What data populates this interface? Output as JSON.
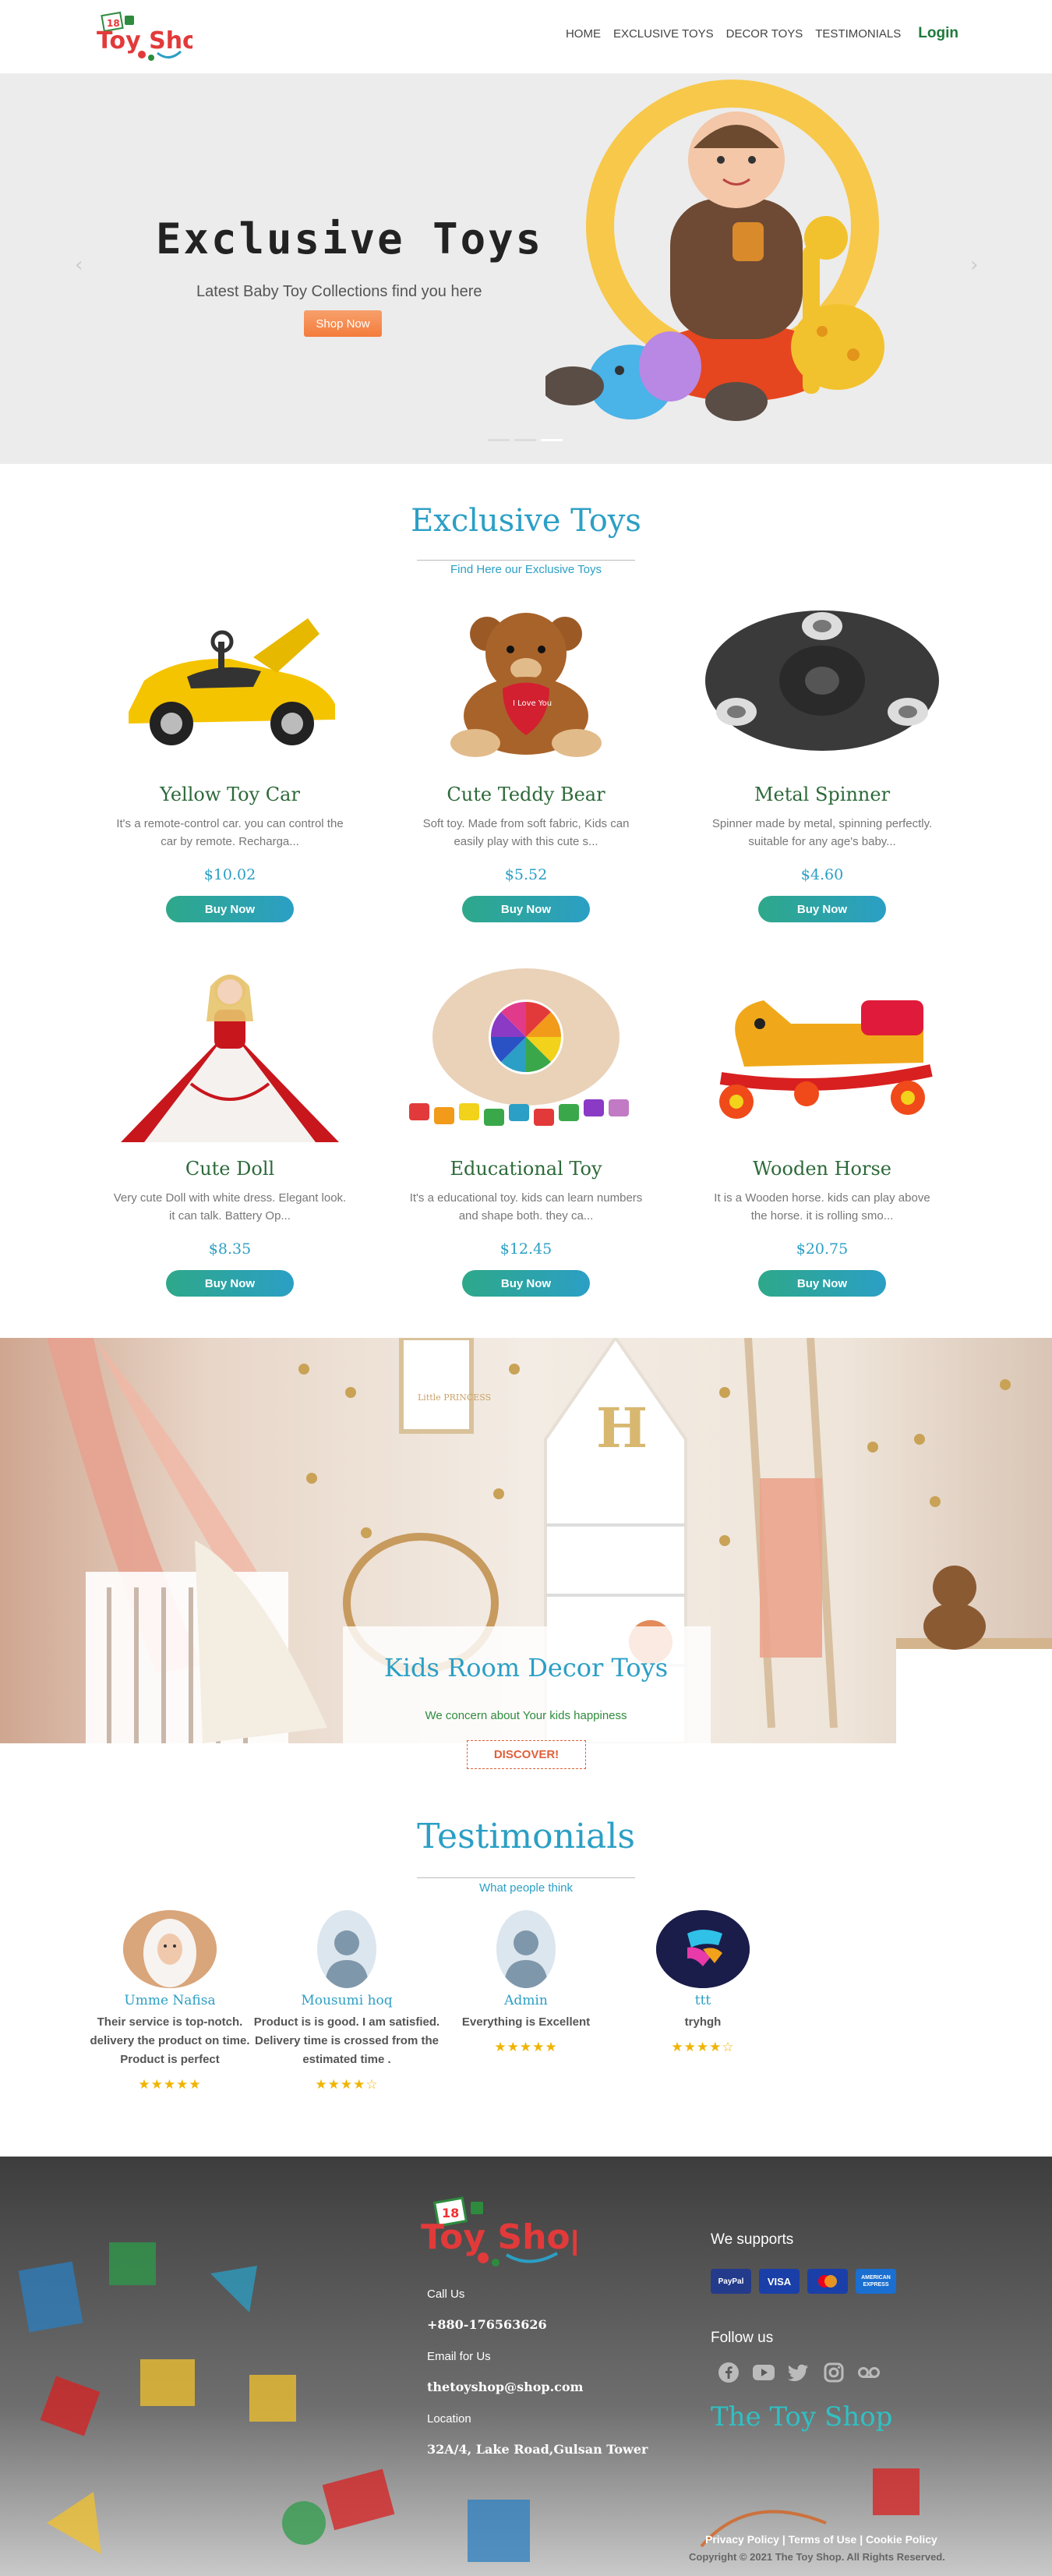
{
  "header": {
    "logo_badge": "18",
    "logo_text": "Toy Shop",
    "nav": [
      "HOME",
      "EXCLUSIVE TOYS",
      "DECOR TOYS",
      "TESTIMONIALS"
    ],
    "login": "Login"
  },
  "hero": {
    "title": "Exclusive Toys",
    "subtitle": "Latest Baby Toy Collections find you here",
    "button": "Shop Now",
    "prev_arrow": "‹",
    "next_arrow": "›"
  },
  "exclusive": {
    "title": "Exclusive Toys",
    "subtitle": "Find Here our Exclusive Toys",
    "products": [
      {
        "name": "Yellow Toy Car",
        "desc": "It's a remote-control car. you can control the car by remote. Recharga...",
        "price": "$10.02",
        "button": "Buy Now",
        "icon": "toy-car"
      },
      {
        "name": "Cute Teddy Bear",
        "desc": "Soft toy. Made from soft fabric, Kids can easily play with this cute s...",
        "price": "$5.52",
        "button": "Buy Now",
        "icon": "teddy-bear"
      },
      {
        "name": "Metal Spinner",
        "desc": "Spinner made by metal, spinning perfectly. suitable for any age's baby...",
        "price": "$4.60",
        "button": "Buy Now",
        "icon": "spinner"
      },
      {
        "name": "Cute Doll",
        "desc": "Very cute Doll with white dress. Elegant look. it can talk. Battery Op...",
        "price": "$8.35",
        "button": "Buy Now",
        "icon": "doll"
      },
      {
        "name": "Educational Toy",
        "desc": "It's a educational toy. kids can learn numbers and shape both. they ca...",
        "price": "$12.45",
        "button": "Buy Now",
        "icon": "educational-toy"
      },
      {
        "name": "Wooden Horse",
        "desc": "It is a Wooden horse. kids can play above the horse. it is rolling smo...",
        "price": "$20.75",
        "button": "Buy Now",
        "icon": "rocking-horse"
      }
    ],
    "teddy_heart_text": "I Love You"
  },
  "decor": {
    "title": "Kids Room Decor Toys",
    "subtitle": "We concern about Your kids happiness",
    "button": "DISCOVER!",
    "frame_text": "Little PRINCESS",
    "letter": "H"
  },
  "testimonials": {
    "title": "Testimonials",
    "subtitle": "What people think",
    "items": [
      {
        "name": "Umme Nafisa",
        "message": "Their service is top-notch. delivery the product on time. Product is perfect",
        "stars": "★★★★★",
        "rating": 5
      },
      {
        "name": "Mousumi hoq",
        "message": "Product is is good. I am satisfied. Delivery time is crossed from the estimated time .",
        "stars": "★★★★☆",
        "rating": 4
      },
      {
        "name": "Admin",
        "message": "Everything is Excellent",
        "stars": "★★★★★",
        "rating": 5
      },
      {
        "name": "ttt",
        "message": "tryhgh",
        "stars": "★★★★☆",
        "rating": 4
      }
    ]
  },
  "footer": {
    "call_label": "Call Us",
    "phone": "+880-176563626",
    "email_label": "Email for Us",
    "email": "thetoyshop@shop.com",
    "location_label": "Location",
    "address": "32A/4, Lake Road,Gulsan Tower",
    "supports_title": "We supports",
    "payments": [
      "PayPal",
      "VISA",
      "",
      "AMERICAN EXPRESS"
    ],
    "follow_title": "Follow us",
    "socials": [
      "facebook-icon",
      "youtube-icon",
      "twitter-icon",
      "instagram-icon",
      "voicemail-icon"
    ],
    "brand": "The Toy Shop",
    "policy": "Privacy Policy | Terms of Use | Cookie Policy",
    "copyright": "Copyright © 2021 The Toy Shop. All Rights Reserved."
  },
  "colors": {
    "accent": "#2b9fc5",
    "green": "#2d6a3a",
    "orange": "#f47c3c",
    "star": "#f0b400"
  }
}
